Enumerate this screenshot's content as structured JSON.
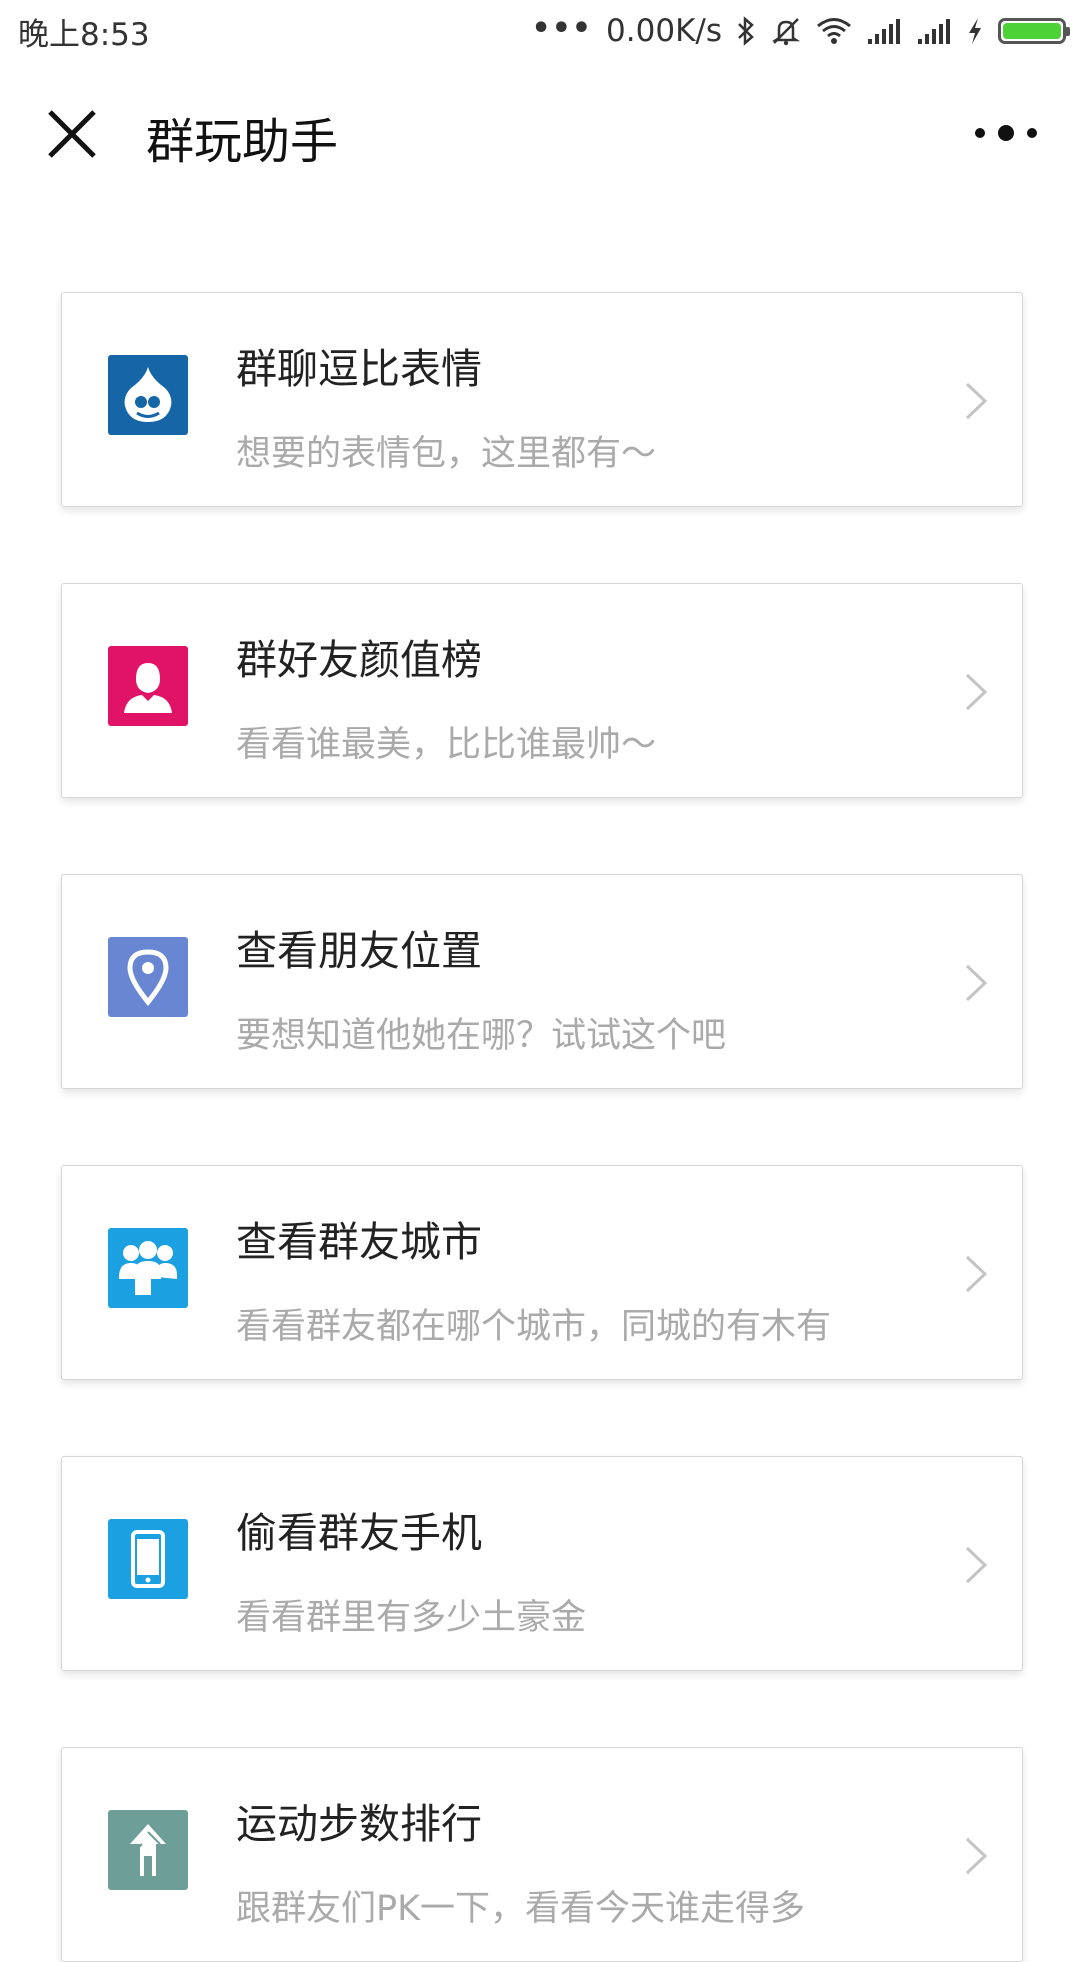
{
  "status_bar": {
    "time": "晚上8:53",
    "network_speed": "0.00K/s",
    "battery_color": "#4cd137"
  },
  "header": {
    "title": "群玩助手",
    "close_icon": "close-icon",
    "more_icon": "more-icon"
  },
  "items": [
    {
      "title": "群聊逗比表情",
      "subtitle": "想要的表情包，这里都有～",
      "icon": "drupal-drop-icon",
      "icon_color": "#1565a7"
    },
    {
      "title": "群好友颜值榜",
      "subtitle": "看看谁最美，比比谁最帅～",
      "icon": "female-user-icon",
      "icon_color": "#e01366"
    },
    {
      "title": "查看朋友位置",
      "subtitle": "要想知道他她在哪？试试这个吧",
      "icon": "location-pin-icon",
      "icon_color": "#6986d2"
    },
    {
      "title": "查看群友城市",
      "subtitle": "看看群友都在哪个城市，同城的有木有",
      "icon": "group-people-icon",
      "icon_color": "#1ba1e2"
    },
    {
      "title": "偷看群友手机",
      "subtitle": "看看群里有多少土豪金",
      "icon": "mobile-phone-icon",
      "icon_color": "#1ba1e2"
    },
    {
      "title": "运动步数排行",
      "subtitle": "跟群友们PK一下，看看今天谁走得多",
      "icon": "step-ranking-icon",
      "icon_color": "#6e9e98"
    }
  ]
}
